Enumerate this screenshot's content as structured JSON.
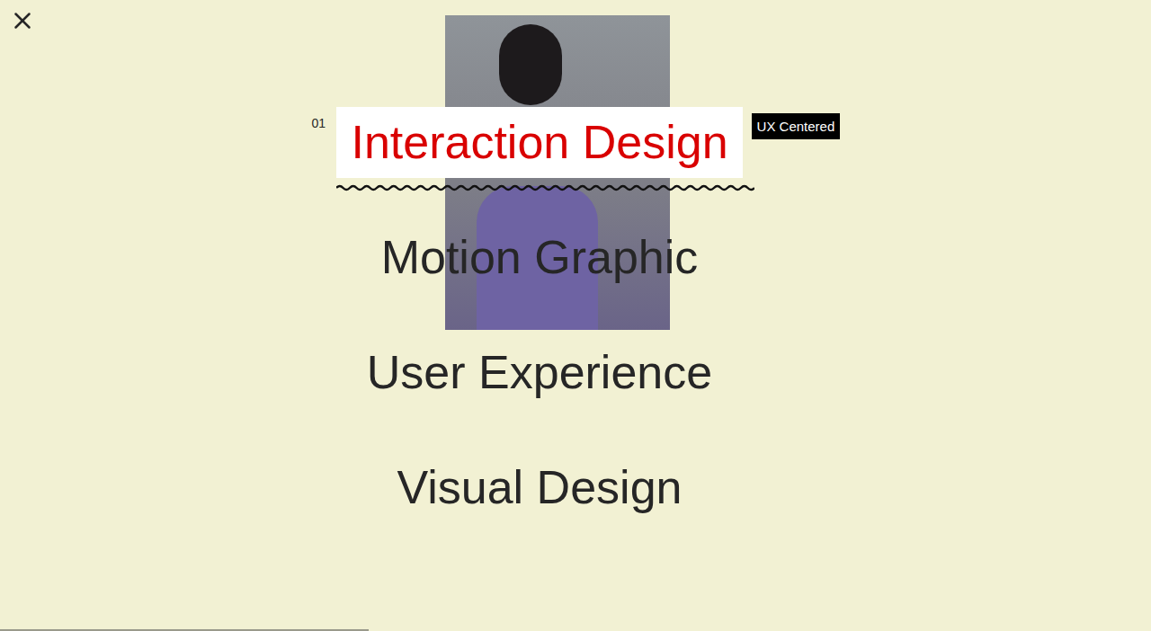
{
  "menu": {
    "items": [
      {
        "label": "Interaction Design",
        "number": "01",
        "badge": "UX Centered",
        "selected": true
      },
      {
        "label": "Motion Graphic",
        "selected": false
      },
      {
        "label": "User Experience",
        "selected": false
      },
      {
        "label": "Visual Design",
        "selected": false
      }
    ]
  },
  "progress": {
    "level": 0.32
  }
}
